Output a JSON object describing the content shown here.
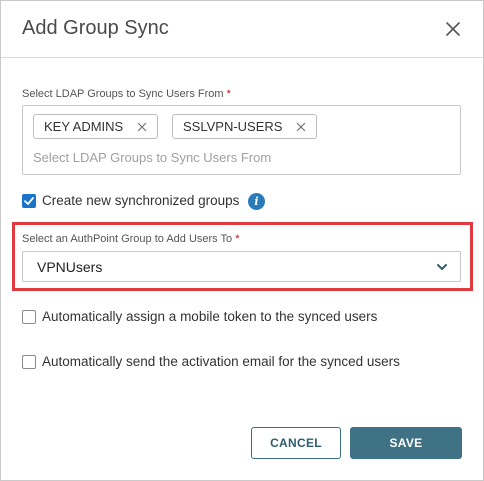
{
  "dialog": {
    "title": "Add Group Sync"
  },
  "ldap_groups": {
    "label": "Select LDAP Groups to Sync Users From",
    "required_mark": "*",
    "chips": [
      "KEY ADMINS",
      "SSLVPN-USERS"
    ],
    "placeholder": "Select LDAP Groups to Sync Users From"
  },
  "create_groups": {
    "label": "Create new synchronized groups",
    "checked": true
  },
  "authpoint_group": {
    "label": "Select an AuthPoint Group to Add Users To",
    "required_mark": "*",
    "value": "VPNUsers"
  },
  "options": {
    "mobile_token_label": "Automatically assign a mobile token to the synced users",
    "activation_email_label": "Automatically send the activation email for the synced users"
  },
  "buttons": {
    "cancel": "CANCEL",
    "save": "SAVE"
  },
  "colors": {
    "primary": "#3f7284",
    "checkbox": "#1a73c8",
    "highlight": "#e0393f",
    "required": "#d0021b",
    "info": "#2b7bb9"
  }
}
